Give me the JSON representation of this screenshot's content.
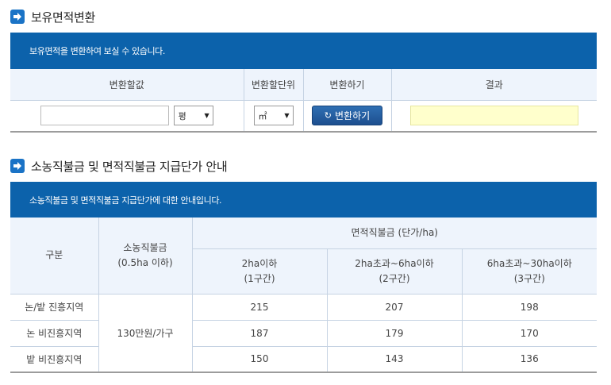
{
  "section1": {
    "title": "보유면적변환",
    "banner": "보유면적을 변환하여 보실 수 있습니다.",
    "headers": [
      "변환할값",
      "변환할단위",
      "변환하기",
      "결과"
    ],
    "value_input": "",
    "from_unit": "평",
    "to_unit": "㎡",
    "convert_button": "변환하기",
    "result": ""
  },
  "section2": {
    "title": "소농직불금 및 면적직불금 지급단가 안내",
    "banner": "소농직불금 및 면적직불금 지급단가에 대한 안내입니다.",
    "head_category": "구분",
    "head_small_farm_1": "소농직불금",
    "head_small_farm_2": "(0.5ha 이하)",
    "head_area": "면적직불금 (단가/ha)",
    "tiers": [
      {
        "line1": "2ha이하",
        "line2": "(1구간)"
      },
      {
        "line1": "2ha초과~6ha이하",
        "line2": "(2구간)"
      },
      {
        "line1": "6ha초과~30ha이하",
        "line2": "(3구간)"
      }
    ],
    "small_farm_amount": "130만원/가구",
    "rows": [
      {
        "label": "논/밭 진흥지역",
        "values": [
          "215",
          "207",
          "198"
        ]
      },
      {
        "label": "논 비진흥지역",
        "values": [
          "187",
          "179",
          "170"
        ]
      },
      {
        "label": "밭 비진흥지역",
        "values": [
          "150",
          "143",
          "136"
        ]
      }
    ]
  },
  "colors": {
    "accent": "#0c62ab",
    "header_bg": "#eef4fc",
    "result_bg": "#ffffcc"
  },
  "icons": {
    "section": "arrow-right-icon",
    "button": "refresh-icon",
    "dropdown": "chevron-down-icon"
  }
}
